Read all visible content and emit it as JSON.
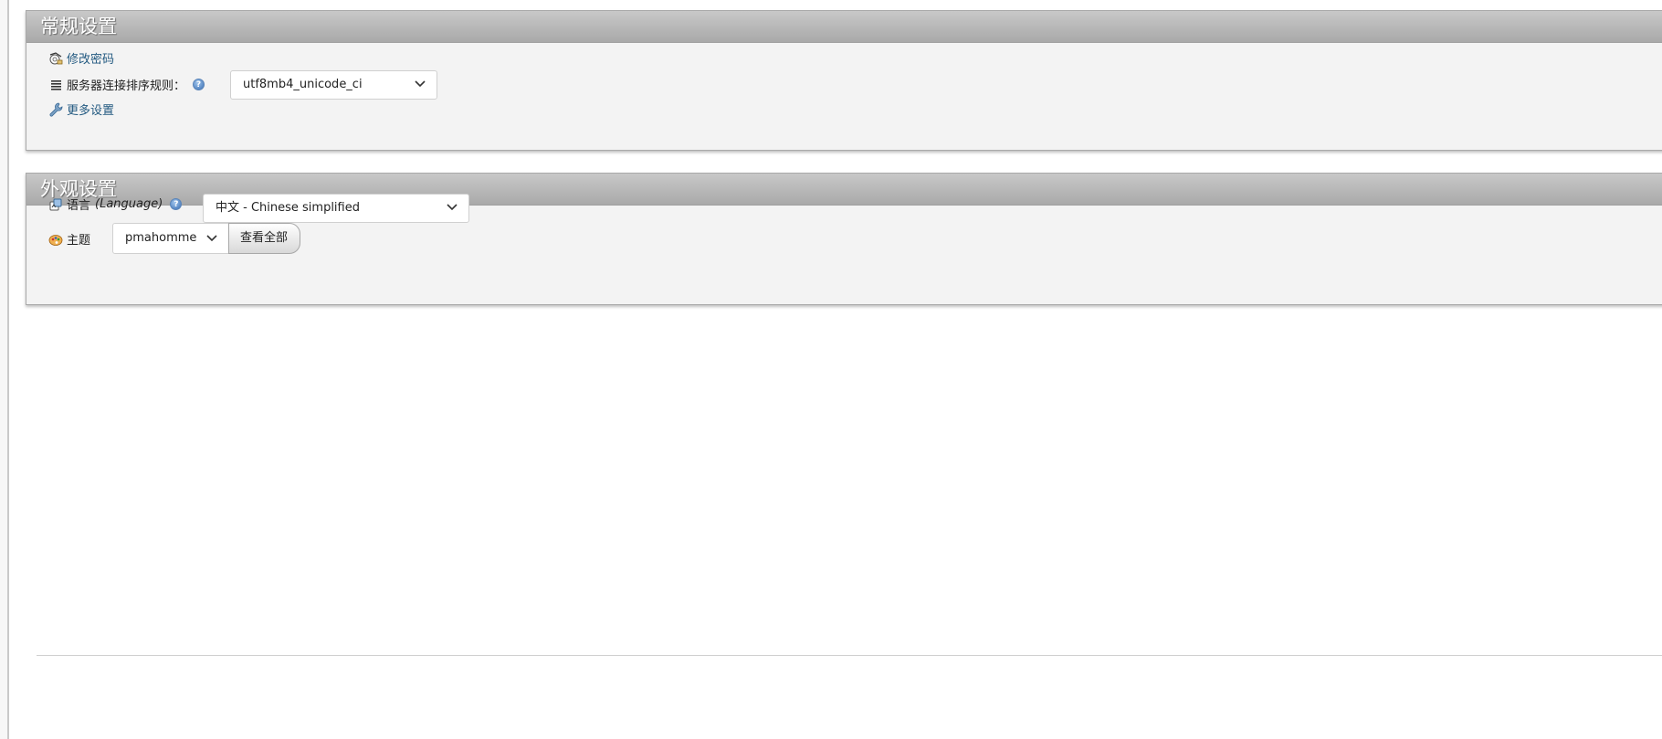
{
  "general_settings": {
    "title": "常规设置",
    "change_password_label": "修改密码",
    "server_collation_label": "服务器连接排序规则：",
    "server_collation_value": "utf8mb4_unicode_ci",
    "more_settings_label": "更多设置"
  },
  "appearance_settings": {
    "title": "外观设置",
    "language_label": "语言",
    "language_label_en": "(Language)",
    "language_value": "中文 - Chinese simplified",
    "theme_label": "主题",
    "theme_value": "pmahomme",
    "view_all_label": "查看全部"
  },
  "icons": {
    "change_password": "password-icon",
    "server_collation": "list-icon",
    "more_settings": "wrench-icon",
    "language": "language-icon",
    "theme": "theme-palette-icon",
    "help": "help-icon",
    "select_chevron": "chevron-down-icon"
  },
  "colors": {
    "link": "#235a81",
    "panel_background": "#f3f3f3",
    "panel_header": "#b3b3b3"
  }
}
